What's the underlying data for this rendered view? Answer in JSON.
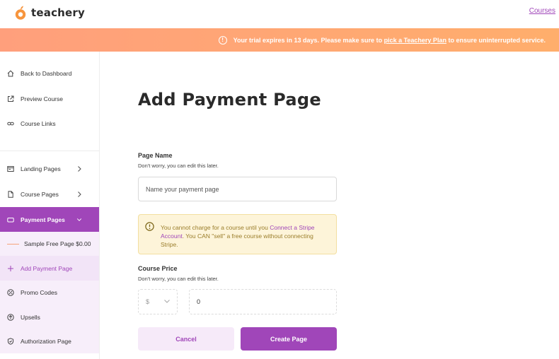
{
  "header": {
    "logo_text": "teachery",
    "courses_link": "Courses"
  },
  "banner": {
    "text_before": "Your trial expires in 13 days. Please make sure to ",
    "link": "pick a Teachery Plan",
    "text_after": " to ensure uninterrupted service."
  },
  "sidebar": {
    "back": "Back to Dashboard",
    "preview": "Preview Course",
    "links": "Course Links",
    "landing": "Landing Pages",
    "course_pages": "Course Pages",
    "payment_pages": "Payment Pages",
    "sample_page": "Sample Free Page $0.00",
    "add_payment": "Add Payment Page",
    "promo": "Promo Codes",
    "upsells": "Upsells",
    "authorization": "Authorization Page"
  },
  "main": {
    "title": "Add Payment Page",
    "page_name_label": "Page Name",
    "page_name_hint": "Don't worry, you can edit this later.",
    "page_name_placeholder": "Name your payment page",
    "warning_before": "You cannot charge for a course until you ",
    "warning_link": "Connect a Stripe Account",
    "warning_after": ". You CAN \"sell\" a free course without connecting Stripe.",
    "price_label": "Course Price",
    "price_hint": "Don't worry, you can edit this later.",
    "currency": "$",
    "price_value": "0",
    "cancel": "Cancel",
    "create": "Create Page"
  },
  "colors": {
    "accent": "#a046b9",
    "banner_start": "#ff9f7c",
    "banner_end": "#ffae6c",
    "warning_bg": "#fdf4d9",
    "warning_text": "#9a7d2a"
  }
}
